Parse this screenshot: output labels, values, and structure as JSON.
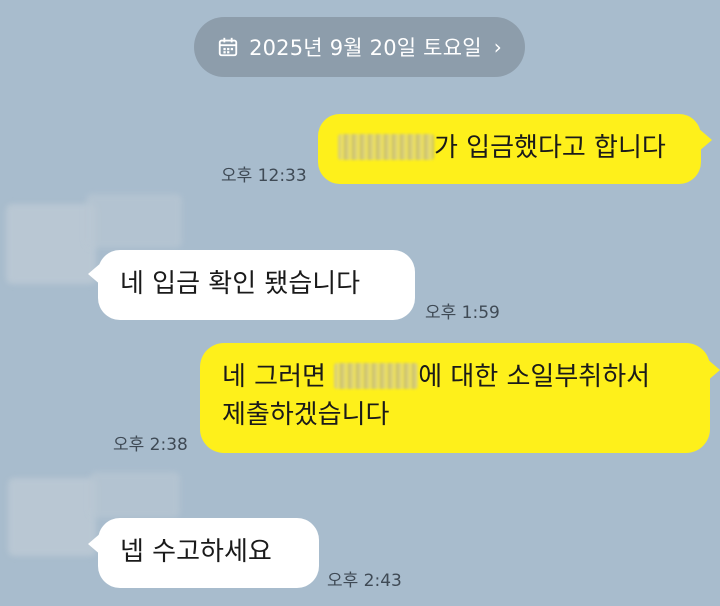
{
  "date_divider": {
    "label": "2025년 9월 20일 토요일",
    "chevron": "›",
    "icon": "calendar-icon"
  },
  "messages": [
    {
      "side": "mine",
      "text_after_redaction": "가 입금했다고 합니다",
      "time": "오후 12:33"
    },
    {
      "side": "theirs",
      "text": "네 입금 확인 됐습니다",
      "time": "오후 1:59"
    },
    {
      "side": "mine",
      "line1_before": "네 그러면 ",
      "line1_after": "에 대한 소일부취하서",
      "line2": "제출하겠습니다",
      "time": "오후 2:38"
    },
    {
      "side": "theirs",
      "text": "넵 수고하세요",
      "time": "오후 2:43"
    }
  ],
  "colors": {
    "background": "#a8bccd",
    "my_bubble": "#fef01b",
    "their_bubble": "#ffffff",
    "date_pill": "#8d9dab"
  }
}
